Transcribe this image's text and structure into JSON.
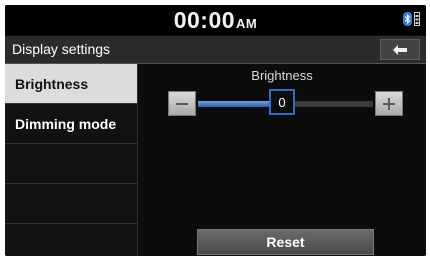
{
  "status_bar": {
    "time": "00:00",
    "ampm": "AM",
    "icons": [
      "bluetooth-icon",
      "phone-battery-icon"
    ]
  },
  "header": {
    "title": "Display settings",
    "back_icon": "back-arrow-icon"
  },
  "sidebar": {
    "items": [
      {
        "label": "Brightness",
        "selected": true
      },
      {
        "label": "Dimming mode",
        "selected": false
      }
    ],
    "empty_rows": 3
  },
  "brightness": {
    "label": "Brightness",
    "value": "0",
    "level_fraction": 0.48,
    "minus_icon": "minus-icon",
    "plus_icon": "plus-icon"
  },
  "reset": {
    "label": "Reset"
  },
  "colors": {
    "accent": "#2e6dc8",
    "selected_bg": "#dcdcdc",
    "panel_bg": "#0c0c0c"
  }
}
